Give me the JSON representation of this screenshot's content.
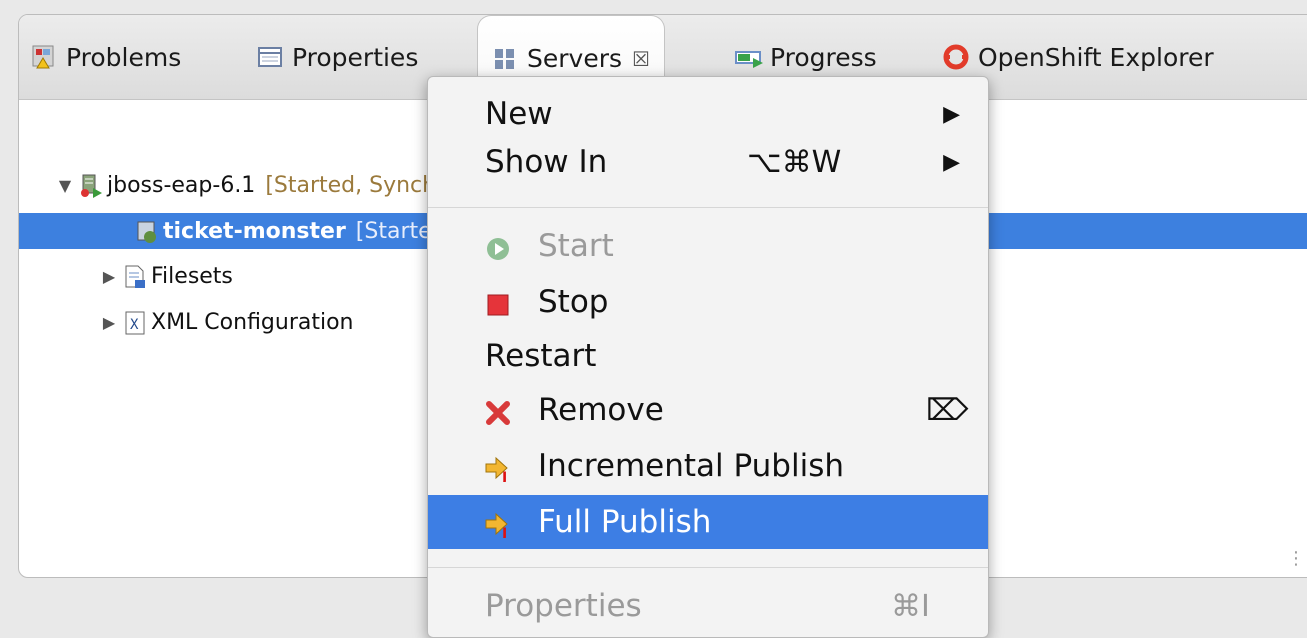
{
  "tabs": [
    {
      "label": "Problems"
    },
    {
      "label": "Properties"
    },
    {
      "label": "Servers",
      "close": "☒"
    },
    {
      "label": "Progress"
    },
    {
      "label": "OpenShift Explorer"
    }
  ],
  "tree": {
    "server": {
      "name": "jboss-eap-6.1",
      "status": "[Started, Synchronized]"
    },
    "module": {
      "name": "ticket-monster",
      "status": "[Started, Synchronized]"
    },
    "filesets": {
      "name": "Filesets"
    },
    "xml": {
      "name": "XML Configuration"
    }
  },
  "menu": {
    "new": {
      "label": "New"
    },
    "show_in": {
      "label": "Show In",
      "shortcut": "⌥⌘W"
    },
    "start": {
      "label": "Start"
    },
    "stop": {
      "label": "Stop"
    },
    "restart": {
      "label": "Restart"
    },
    "remove": {
      "label": "Remove",
      "shortcut": "⌦"
    },
    "incremental": {
      "label": "Incremental Publish"
    },
    "full": {
      "label": "Full Publish"
    },
    "properties": {
      "label": "Properties",
      "shortcut": "⌘I"
    }
  },
  "colors": {
    "selection": "#3d80df",
    "menu_highlight": "#3d7ee4",
    "status": "#9b7a3c"
  }
}
